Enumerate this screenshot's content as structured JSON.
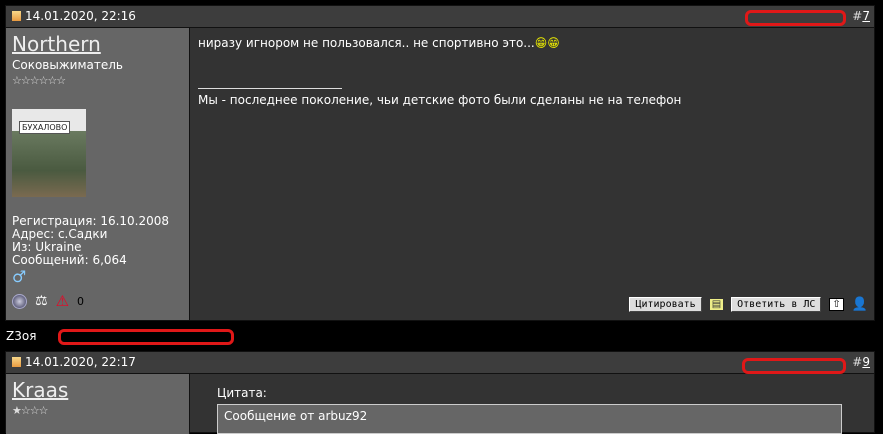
{
  "posts": [
    {
      "date": "14.01.2020, 22:16",
      "number": "7",
      "username": "Northern",
      "user_title": "Соковыжиматель",
      "stars": "☆☆☆☆☆☆",
      "avatar_sign": "БУХАЛОВО",
      "info": [
        "Регистрация: 16.10.2008",
        "Адрес: с.Садки",
        "Из: Ukraine",
        "Сообщений: 6,064"
      ],
      "message": "ниразу игнором не пользовался.. не спортивно это...",
      "signature": "Мы - последнее поколение, чьи детские фото были сделаны не на телефон",
      "quote_button": "Цитировать",
      "pm_button": "Ответить в ЛС",
      "reputation_count": "0"
    },
    {
      "date": "14.01.2020, 22:17",
      "number": "9",
      "username": "Kraas",
      "stars": "★☆☆☆",
      "quote_label": "Цитата:",
      "quote_from": "Сообщение от arbuz92"
    }
  ],
  "separator_text": "Z3оя"
}
